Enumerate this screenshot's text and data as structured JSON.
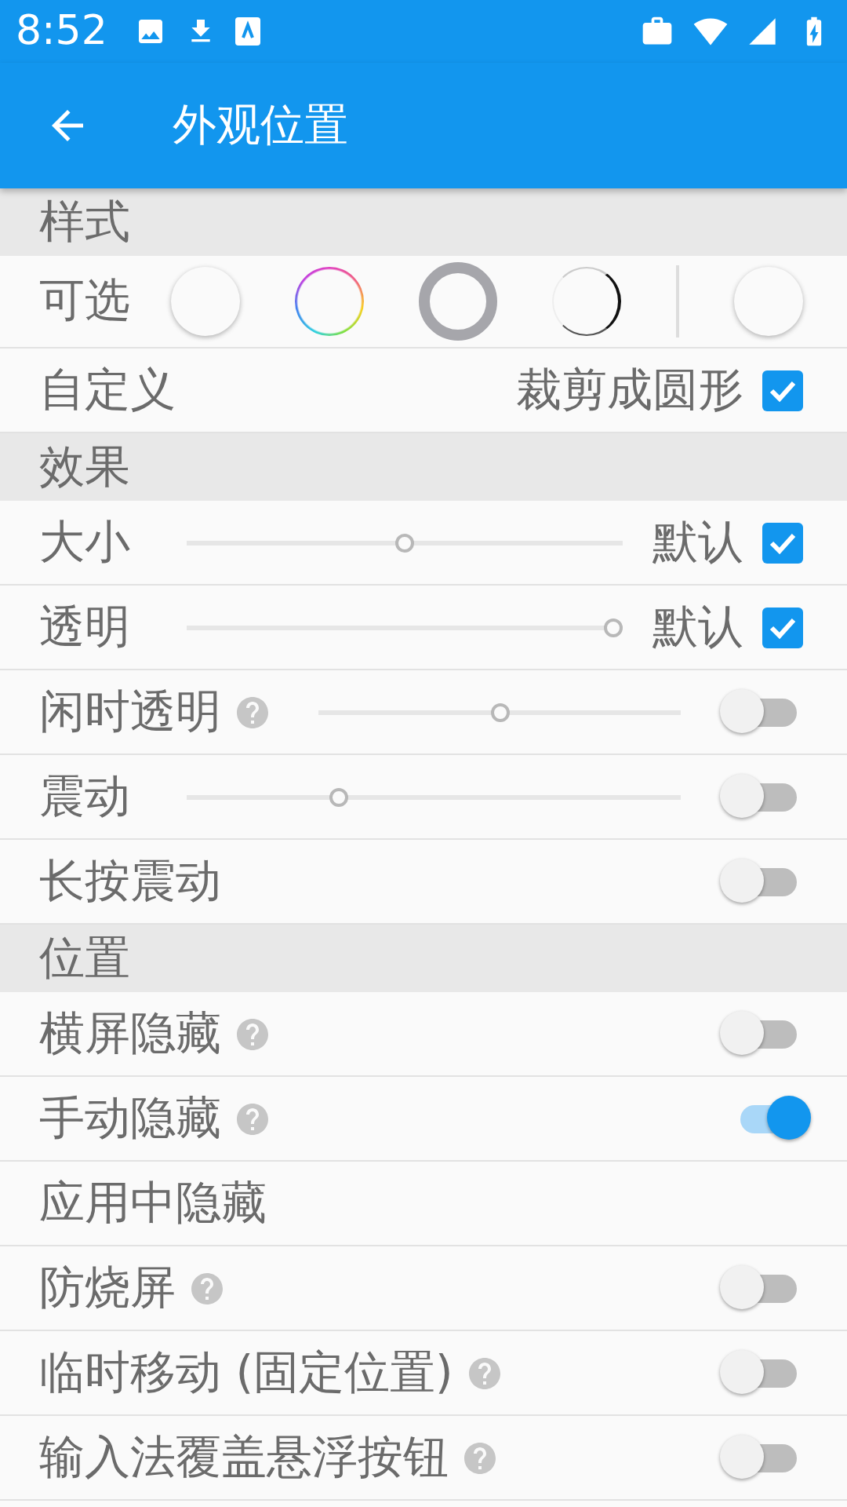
{
  "status_bar": {
    "time": "8:52"
  },
  "app_bar": {
    "title": "外观位置"
  },
  "sections": [
    {
      "title": "样式",
      "rows": [
        {
          "kind": "styles",
          "label": "可选",
          "options": [
            {
              "kind": "plain"
            },
            {
              "kind": "rainbow"
            },
            {
              "kind": "ring"
            },
            {
              "kind": "half"
            },
            {
              "kind": "separator"
            },
            {
              "kind": "plain"
            }
          ]
        },
        {
          "kind": "setting",
          "label": "自定义",
          "help": false,
          "checkbox": {
            "text": "裁剪成圆形",
            "checked": true
          }
        }
      ]
    },
    {
      "title": "效果",
      "rows": [
        {
          "kind": "setting",
          "label": "大小",
          "help": false,
          "slider": {
            "level": 0.5
          },
          "checkbox": {
            "text": "默认",
            "checked": true
          }
        },
        {
          "kind": "setting",
          "label": "透明",
          "help": false,
          "slider": {
            "level": 1
          },
          "checkbox": {
            "text": "默认",
            "checked": true
          }
        },
        {
          "kind": "setting",
          "label": "闲时透明",
          "help": true,
          "slider": {
            "level": 0.5
          },
          "switch": {
            "on": false
          }
        },
        {
          "kind": "setting",
          "label": "震动",
          "help": false,
          "slider": {
            "level": 0.3
          },
          "switch": {
            "on": false
          }
        },
        {
          "kind": "setting",
          "label": "长按震动",
          "help": false,
          "switch": {
            "on": false
          }
        }
      ]
    },
    {
      "title": "位置",
      "rows": [
        {
          "kind": "setting",
          "label": "横屏隐藏",
          "help": true,
          "switch": {
            "on": false
          }
        },
        {
          "kind": "setting",
          "label": "手动隐藏",
          "help": true,
          "switch": {
            "on": true
          }
        },
        {
          "kind": "setting",
          "label": "应用中隐藏",
          "help": false
        },
        {
          "kind": "setting",
          "label": "防烧屏",
          "help": true,
          "switch": {
            "on": false
          }
        },
        {
          "kind": "setting",
          "label": "临时移动 (固定位置)",
          "help": true,
          "switch": {
            "on": false
          }
        },
        {
          "kind": "setting",
          "label": "输入法覆盖悬浮按钮",
          "help": true,
          "switch": {
            "on": false
          }
        }
      ]
    }
  ]
}
